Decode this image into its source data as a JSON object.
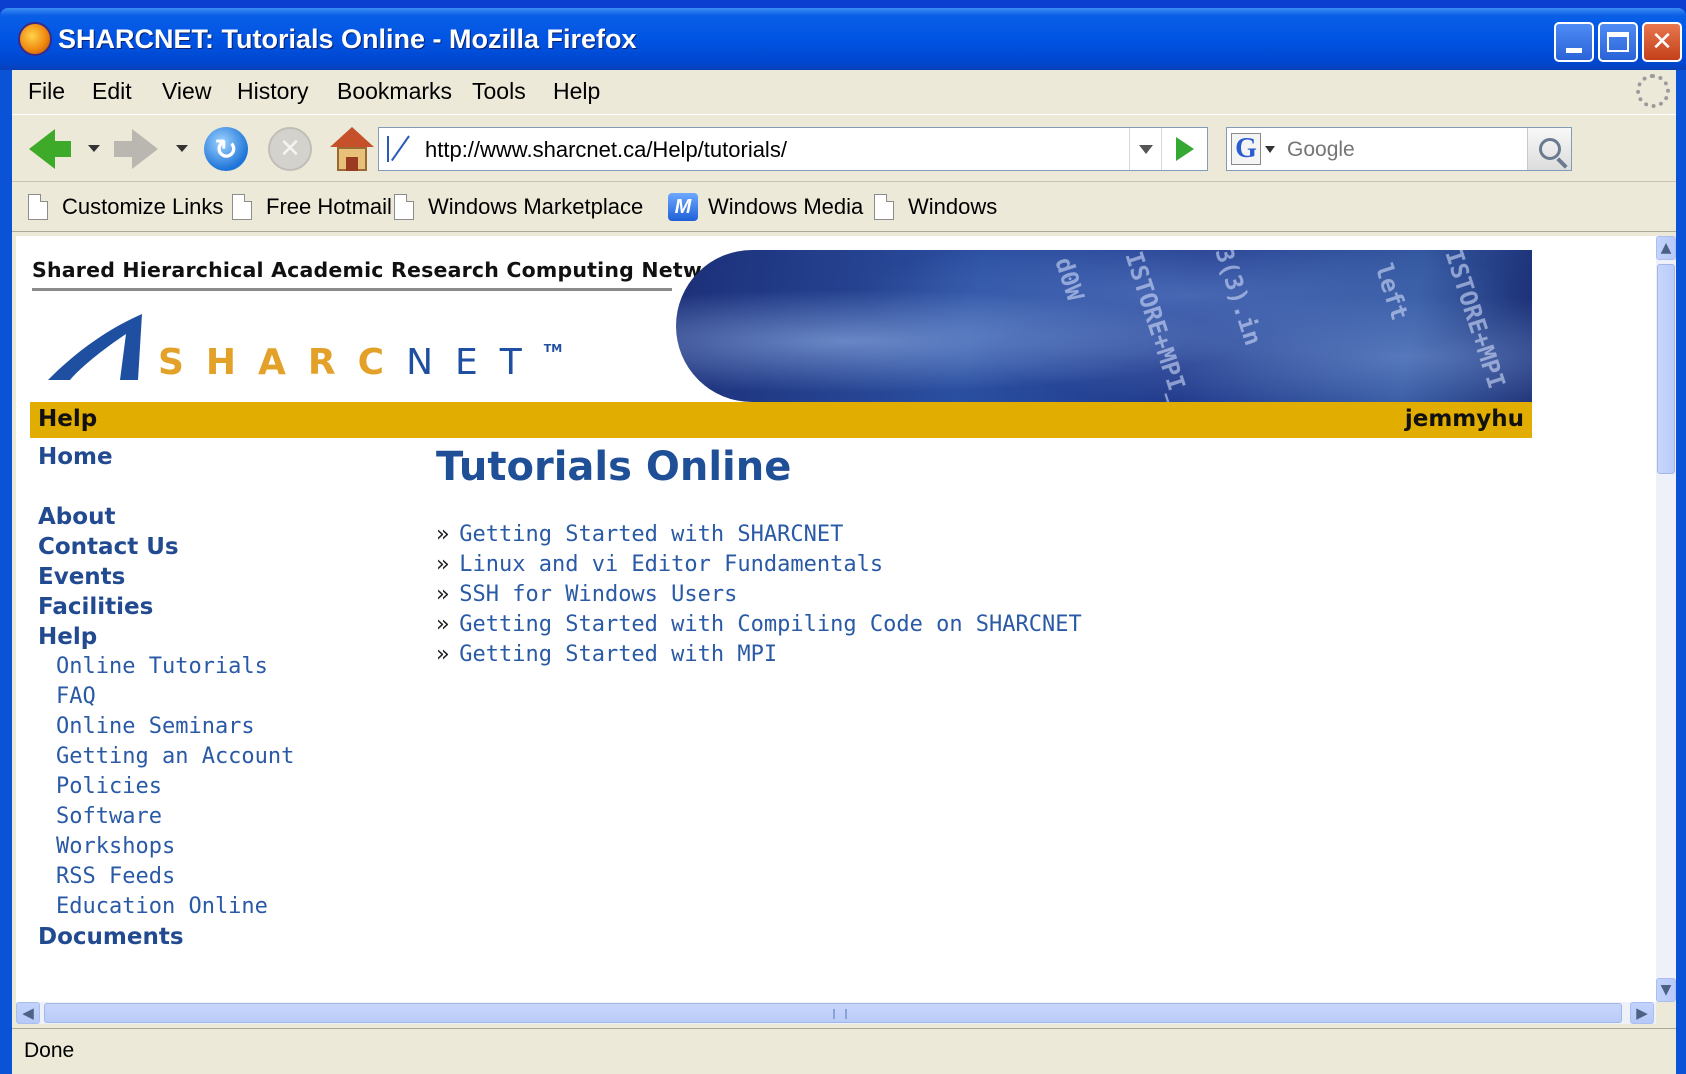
{
  "window": {
    "title": "SHARCNET: Tutorials Online - Mozilla Firefox"
  },
  "menubar": {
    "items": [
      "File",
      "Edit",
      "View",
      "History",
      "Bookmarks",
      "Tools",
      "Help"
    ]
  },
  "navigation": {
    "url": "http://www.sharcnet.ca/Help/tutorials/",
    "search_placeholder": "Google",
    "search_engine_icon": "google-g-icon"
  },
  "bookmarks": {
    "items": [
      {
        "label": "Customize Links",
        "icon": "page-icon"
      },
      {
        "label": "Free Hotmail",
        "icon": "page-icon"
      },
      {
        "label": "Windows Marketplace",
        "icon": "page-icon"
      },
      {
        "label": "Windows Media",
        "icon": "windows-media-icon"
      },
      {
        "label": "Windows",
        "icon": "page-icon"
      }
    ]
  },
  "site": {
    "tagline": "Shared Hierarchical Academic Research Computing Network",
    "logo_gold": "SHARC",
    "logo_blue": "NET",
    "logo_tm": "TM",
    "banner_texts": [
      "d0W",
      "ISTORE+MPI_I",
      "3(3).in",
      "ISTORE+MPI",
      "left"
    ],
    "section_label": "Help",
    "user": "jemmyhu",
    "colors": {
      "section_bar": "#e1ad01",
      "link": "#2a5aa6",
      "heading": "#1f4f96"
    }
  },
  "sidenav": {
    "main_top": [
      "Home"
    ],
    "main": [
      "About",
      "Contact Us",
      "Events",
      "Facilities",
      "Help"
    ],
    "help_sub": [
      "Online Tutorials",
      "FAQ",
      "Online Seminars",
      "Getting an Account",
      "Policies",
      "Software",
      "Workshops",
      "RSS Feeds",
      "Education Online"
    ],
    "partial": "Documents"
  },
  "main": {
    "title": "Tutorials Online",
    "bullet": "»",
    "tutorials": [
      "Getting Started with SHARCNET",
      "Linux and vi Editor Fundamentals",
      "SSH for Windows Users",
      "Getting Started with Compiling Code on SHARCNET",
      "Getting Started with MPI"
    ]
  },
  "status": {
    "text": "Done"
  }
}
